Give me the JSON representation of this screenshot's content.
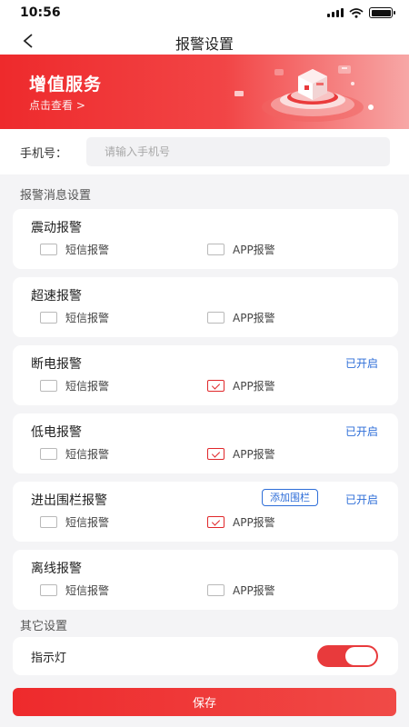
{
  "status_bar": {
    "time": "10:56"
  },
  "nav": {
    "title": "报警设置"
  },
  "banner": {
    "title": "增值服务",
    "link": "点击查看 >"
  },
  "phone": {
    "label": "手机号：",
    "placeholder": "请输入手机号",
    "value": ""
  },
  "alarm_section_title": "报警消息设置",
  "alarms": [
    {
      "name": "震动报警",
      "sms_label": "短信报警",
      "app_label": "APP报警",
      "sms_checked": false,
      "app_checked": false,
      "status": ""
    },
    {
      "name": "超速报警",
      "sms_label": "短信报警",
      "app_label": "APP报警",
      "sms_checked": false,
      "app_checked": false,
      "status": ""
    },
    {
      "name": "断电报警",
      "sms_label": "短信报警",
      "app_label": "APP报警",
      "sms_checked": false,
      "app_checked": true,
      "status": "已开启"
    },
    {
      "name": "低电报警",
      "sms_label": "短信报警",
      "app_label": "APP报警",
      "sms_checked": false,
      "app_checked": true,
      "status": "已开启"
    },
    {
      "name": "进出围栏报警",
      "sms_label": "短信报警",
      "app_label": "APP报警",
      "sms_checked": false,
      "app_checked": true,
      "status": "已开启",
      "action": "添加围栏"
    },
    {
      "name": "离线报警",
      "sms_label": "短信报警",
      "app_label": "APP报警",
      "sms_checked": false,
      "app_checked": false,
      "status": ""
    }
  ],
  "other_section_title": "其它设置",
  "indicator": {
    "label": "指示灯",
    "enabled": true
  },
  "save_label": "保存",
  "colors": {
    "accent": "#E8292B",
    "link_blue": "#2E6ED8"
  }
}
